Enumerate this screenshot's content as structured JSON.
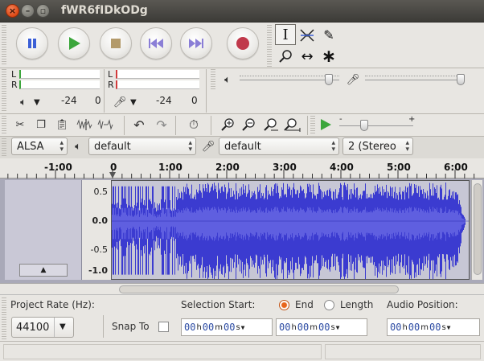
{
  "window": {
    "title": "fWR6fIDkODg"
  },
  "transport": {
    "pause_icon": "pause-icon",
    "play_icon": "play-icon",
    "stop_icon": "stop-icon",
    "skip_start_icon": "skip-to-start-icon",
    "skip_end_icon": "skip-to-end-icon",
    "record_icon": "record-icon"
  },
  "meters": {
    "playback": {
      "left_label": "L",
      "right_label": "R",
      "scale_a": "-24",
      "scale_b": "0"
    },
    "record": {
      "left_label": "L",
      "right_label": "R",
      "scale_a": "-24",
      "scale_b": "0"
    }
  },
  "mixer": {
    "output_volume": 0.87,
    "input_volume": 0.87
  },
  "play_at_speed": {
    "minus": "-",
    "plus": "+",
    "speed": 0.2
  },
  "device": {
    "host": "ALSA",
    "output_device": "default",
    "input_device": "default",
    "channels": "2 (Stereo"
  },
  "timeline": {
    "ticks": [
      "-1:00",
      "0",
      "1:00",
      "2:00",
      "3:00",
      "4:00",
      "5:00",
      "6:00"
    ]
  },
  "track": {
    "scale": [
      "0.5",
      "0.0",
      "-0.5",
      "-1.0"
    ],
    "wave_color": "#3b3bd0",
    "bg_color": "#c7c7d5"
  },
  "selection": {
    "project_rate_label": "Project Rate (Hz):",
    "project_rate": "44100",
    "snap_to_label": "Snap To",
    "selection_start_label": "Selection Start:",
    "end_label": "End",
    "length_label": "Length",
    "audio_position_label": "Audio Position:",
    "time_start": {
      "h": "00",
      "m": "00",
      "s": "00"
    },
    "time_end": {
      "h": "00",
      "m": "00",
      "s": "00"
    },
    "time_pos": {
      "h": "00",
      "m": "00",
      "s": "00"
    },
    "unit_h": "h",
    "unit_m": "m",
    "unit_s": "s"
  }
}
